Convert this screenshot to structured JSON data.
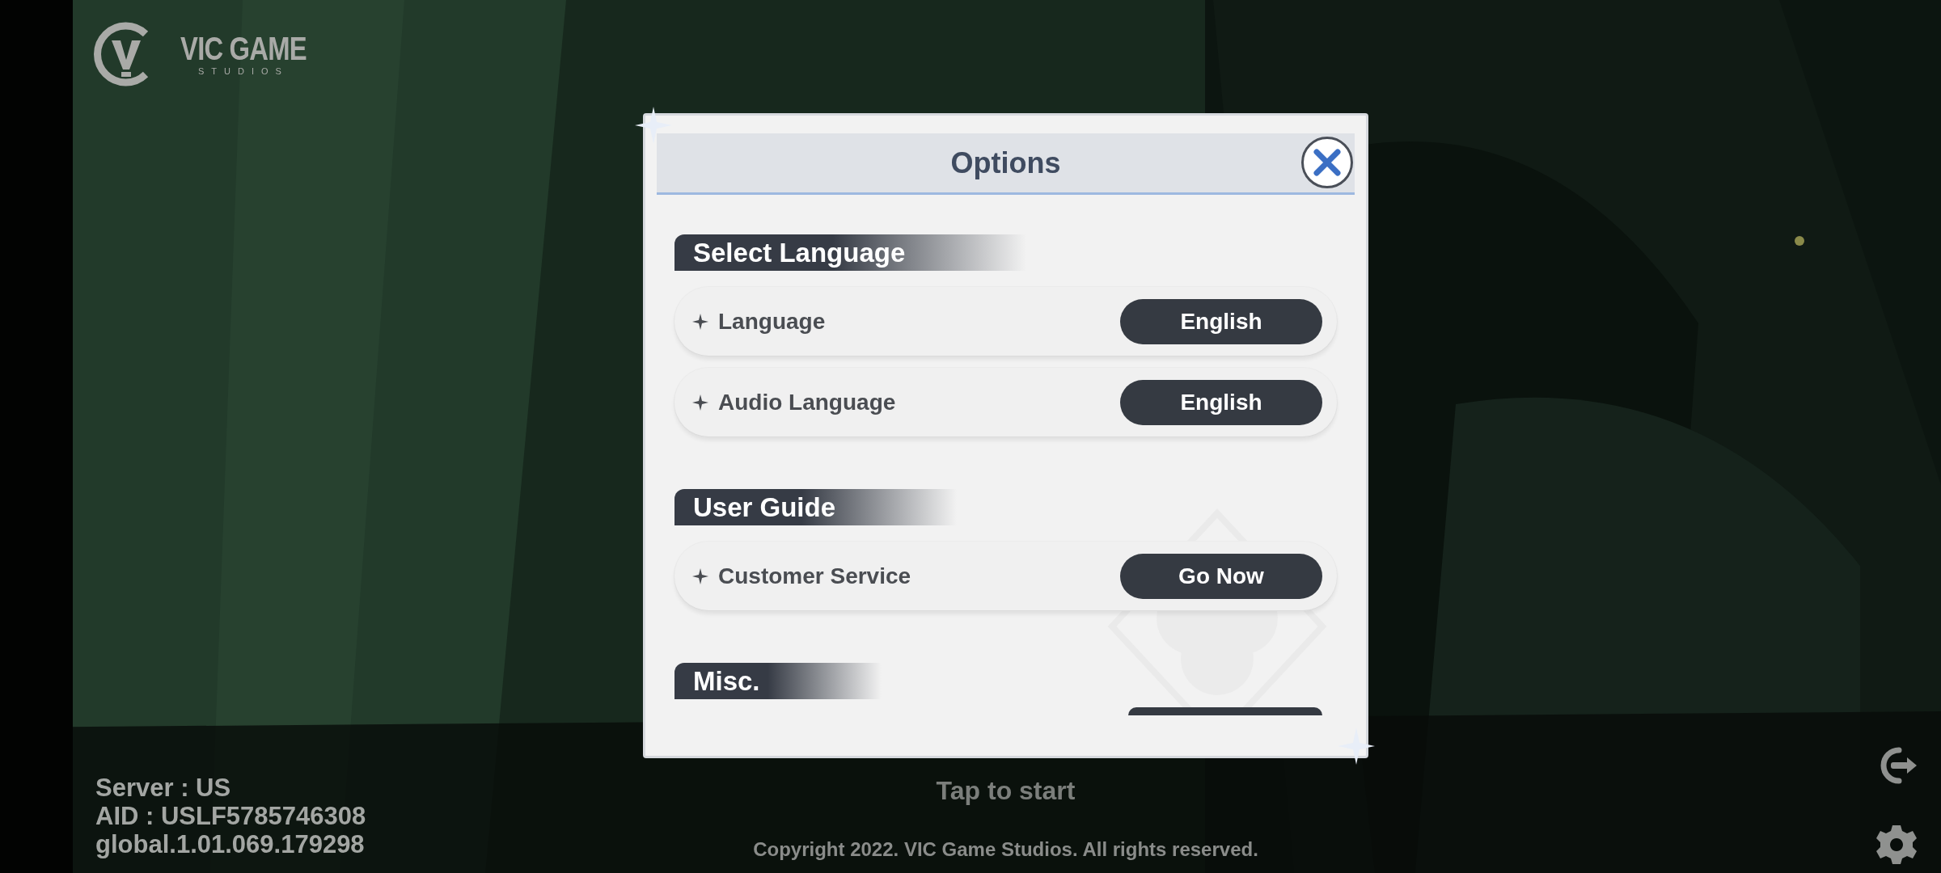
{
  "logo": {
    "name": "VIC GAME",
    "subtitle": "STUDIOS"
  },
  "dialog": {
    "title": "Options",
    "sections": [
      {
        "title": "Select Language",
        "rows": [
          {
            "label": "Language",
            "button": "English"
          },
          {
            "label": "Audio Language",
            "button": "English"
          }
        ]
      },
      {
        "title": "User Guide",
        "rows": [
          {
            "label": "Customer Service",
            "button": "Go Now"
          }
        ]
      },
      {
        "title": "Misc.",
        "cut_off": true
      }
    ]
  },
  "info": {
    "server": "Server : US",
    "aid": "AID : USLF5785746308",
    "version": "global.1.01.069.179298"
  },
  "tap_hint": "Tap to start",
  "copyright": "Copyright 2022. VIC Game Studios. All rights reserved."
}
